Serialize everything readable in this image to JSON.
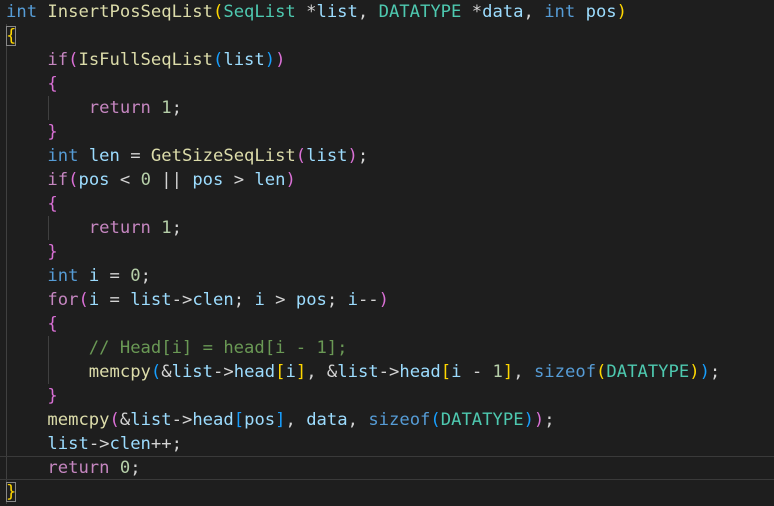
{
  "editor": {
    "language": "c",
    "colors": {
      "background": "#1e1e1e",
      "keyword": "#569cd6",
      "control": "#c586c0",
      "function": "#dcdcaa",
      "type": "#4ec9b0",
      "variable": "#9cdcfe",
      "number": "#b5cea8",
      "comment": "#6a9955",
      "text": "#d4d4d4",
      "bracket1": "#ffd700",
      "bracket2": "#da70d6",
      "bracket3": "#179fff"
    },
    "lines": [
      [
        [
          "int",
          "#569cd6"
        ],
        [
          " ",
          "#d4d4d4"
        ],
        [
          "InsertPosSeqList",
          "#dcdcaa"
        ],
        [
          "(",
          "#ffd700"
        ],
        [
          "SeqList",
          "#4ec9b0"
        ],
        [
          " *",
          "#d4d4d4"
        ],
        [
          "list",
          "#9cdcfe"
        ],
        [
          ", ",
          "#d4d4d4"
        ],
        [
          "DATATYPE",
          "#4ec9b0"
        ],
        [
          " *",
          "#d4d4d4"
        ],
        [
          "data",
          "#9cdcfe"
        ],
        [
          ", ",
          "#d4d4d4"
        ],
        [
          "int",
          "#569cd6"
        ],
        [
          " ",
          "#d4d4d4"
        ],
        [
          "pos",
          "#9cdcfe"
        ],
        [
          ")",
          "#ffd700"
        ]
      ],
      [
        [
          "{",
          "#ffd700"
        ]
      ],
      [
        [
          "    ",
          "#d4d4d4"
        ],
        [
          "if",
          "#c586c0"
        ],
        [
          "(",
          "#da70d6"
        ],
        [
          "IsFullSeqList",
          "#dcdcaa"
        ],
        [
          "(",
          "#179fff"
        ],
        [
          "list",
          "#9cdcfe"
        ],
        [
          ")",
          "#179fff"
        ],
        [
          ")",
          "#da70d6"
        ]
      ],
      [
        [
          "    ",
          "#d4d4d4"
        ],
        [
          "{",
          "#da70d6"
        ]
      ],
      [
        [
          "        ",
          "#d4d4d4"
        ],
        [
          "return",
          "#c586c0"
        ],
        [
          " ",
          "#d4d4d4"
        ],
        [
          "1",
          "#b5cea8"
        ],
        [
          ";",
          "#d4d4d4"
        ]
      ],
      [
        [
          "    ",
          "#d4d4d4"
        ],
        [
          "}",
          "#da70d6"
        ]
      ],
      [
        [
          "    ",
          "#d4d4d4"
        ],
        [
          "int",
          "#569cd6"
        ],
        [
          " ",
          "#d4d4d4"
        ],
        [
          "len",
          "#9cdcfe"
        ],
        [
          " = ",
          "#d4d4d4"
        ],
        [
          "GetSizeSeqList",
          "#dcdcaa"
        ],
        [
          "(",
          "#da70d6"
        ],
        [
          "list",
          "#9cdcfe"
        ],
        [
          ")",
          "#da70d6"
        ],
        [
          ";",
          "#d4d4d4"
        ]
      ],
      [
        [
          "    ",
          "#d4d4d4"
        ],
        [
          "if",
          "#c586c0"
        ],
        [
          "(",
          "#da70d6"
        ],
        [
          "pos",
          "#9cdcfe"
        ],
        [
          " < ",
          "#d4d4d4"
        ],
        [
          "0",
          "#b5cea8"
        ],
        [
          " || ",
          "#d4d4d4"
        ],
        [
          "pos",
          "#9cdcfe"
        ],
        [
          " > ",
          "#d4d4d4"
        ],
        [
          "len",
          "#9cdcfe"
        ],
        [
          ")",
          "#da70d6"
        ]
      ],
      [
        [
          "    ",
          "#d4d4d4"
        ],
        [
          "{",
          "#da70d6"
        ]
      ],
      [
        [
          "        ",
          "#d4d4d4"
        ],
        [
          "return",
          "#c586c0"
        ],
        [
          " ",
          "#d4d4d4"
        ],
        [
          "1",
          "#b5cea8"
        ],
        [
          ";",
          "#d4d4d4"
        ]
      ],
      [
        [
          "    ",
          "#d4d4d4"
        ],
        [
          "}",
          "#da70d6"
        ]
      ],
      [
        [
          "    ",
          "#d4d4d4"
        ],
        [
          "int",
          "#569cd6"
        ],
        [
          " ",
          "#d4d4d4"
        ],
        [
          "i",
          "#9cdcfe"
        ],
        [
          " = ",
          "#d4d4d4"
        ],
        [
          "0",
          "#b5cea8"
        ],
        [
          ";",
          "#d4d4d4"
        ]
      ],
      [
        [
          "    ",
          "#d4d4d4"
        ],
        [
          "for",
          "#c586c0"
        ],
        [
          "(",
          "#da70d6"
        ],
        [
          "i",
          "#9cdcfe"
        ],
        [
          " = ",
          "#d4d4d4"
        ],
        [
          "list",
          "#9cdcfe"
        ],
        [
          "->",
          "#d4d4d4"
        ],
        [
          "clen",
          "#9cdcfe"
        ],
        [
          "; ",
          "#d4d4d4"
        ],
        [
          "i",
          "#9cdcfe"
        ],
        [
          " > ",
          "#d4d4d4"
        ],
        [
          "pos",
          "#9cdcfe"
        ],
        [
          "; ",
          "#d4d4d4"
        ],
        [
          "i",
          "#9cdcfe"
        ],
        [
          "--",
          "#d4d4d4"
        ],
        [
          ")",
          "#da70d6"
        ]
      ],
      [
        [
          "    ",
          "#d4d4d4"
        ],
        [
          "{",
          "#da70d6"
        ]
      ],
      [
        [
          "        ",
          "#d4d4d4"
        ],
        [
          "// Head[i] = head[i - 1];",
          "#6a9955"
        ]
      ],
      [
        [
          "        ",
          "#d4d4d4"
        ],
        [
          "memcpy",
          "#dcdcaa"
        ],
        [
          "(",
          "#179fff"
        ],
        [
          "&",
          "#d4d4d4"
        ],
        [
          "list",
          "#9cdcfe"
        ],
        [
          "->",
          "#d4d4d4"
        ],
        [
          "head",
          "#9cdcfe"
        ],
        [
          "[",
          "#ffd700"
        ],
        [
          "i",
          "#9cdcfe"
        ],
        [
          "]",
          "#ffd700"
        ],
        [
          ", &",
          "#d4d4d4"
        ],
        [
          "list",
          "#9cdcfe"
        ],
        [
          "->",
          "#d4d4d4"
        ],
        [
          "head",
          "#9cdcfe"
        ],
        [
          "[",
          "#ffd700"
        ],
        [
          "i",
          "#9cdcfe"
        ],
        [
          " - ",
          "#d4d4d4"
        ],
        [
          "1",
          "#b5cea8"
        ],
        [
          "]",
          "#ffd700"
        ],
        [
          ", ",
          "#d4d4d4"
        ],
        [
          "sizeof",
          "#569cd6"
        ],
        [
          "(",
          "#ffd700"
        ],
        [
          "DATATYPE",
          "#4ec9b0"
        ],
        [
          ")",
          "#ffd700"
        ],
        [
          ")",
          "#179fff"
        ],
        [
          ";",
          "#d4d4d4"
        ]
      ],
      [
        [
          "    ",
          "#d4d4d4"
        ],
        [
          "}",
          "#da70d6"
        ]
      ],
      [
        [
          "    ",
          "#d4d4d4"
        ],
        [
          "memcpy",
          "#dcdcaa"
        ],
        [
          "(",
          "#da70d6"
        ],
        [
          "&",
          "#d4d4d4"
        ],
        [
          "list",
          "#9cdcfe"
        ],
        [
          "->",
          "#d4d4d4"
        ],
        [
          "head",
          "#9cdcfe"
        ],
        [
          "[",
          "#179fff"
        ],
        [
          "pos",
          "#9cdcfe"
        ],
        [
          "]",
          "#179fff"
        ],
        [
          ", ",
          "#d4d4d4"
        ],
        [
          "data",
          "#9cdcfe"
        ],
        [
          ", ",
          "#d4d4d4"
        ],
        [
          "sizeof",
          "#569cd6"
        ],
        [
          "(",
          "#179fff"
        ],
        [
          "DATATYPE",
          "#4ec9b0"
        ],
        [
          ")",
          "#179fff"
        ],
        [
          ")",
          "#da70d6"
        ],
        [
          ";",
          "#d4d4d4"
        ]
      ],
      [
        [
          "    ",
          "#d4d4d4"
        ],
        [
          "list",
          "#9cdcfe"
        ],
        [
          "->",
          "#d4d4d4"
        ],
        [
          "clen",
          "#9cdcfe"
        ],
        [
          "++;",
          "#d4d4d4"
        ]
      ],
      [
        [
          "    ",
          "#d4d4d4"
        ],
        [
          "return",
          "#c586c0"
        ],
        [
          " ",
          "#d4d4d4"
        ],
        [
          "0",
          "#b5cea8"
        ],
        [
          ";",
          "#d4d4d4"
        ]
      ],
      [
        [
          "}",
          "#ffd700"
        ]
      ]
    ],
    "current_line": 19
  }
}
